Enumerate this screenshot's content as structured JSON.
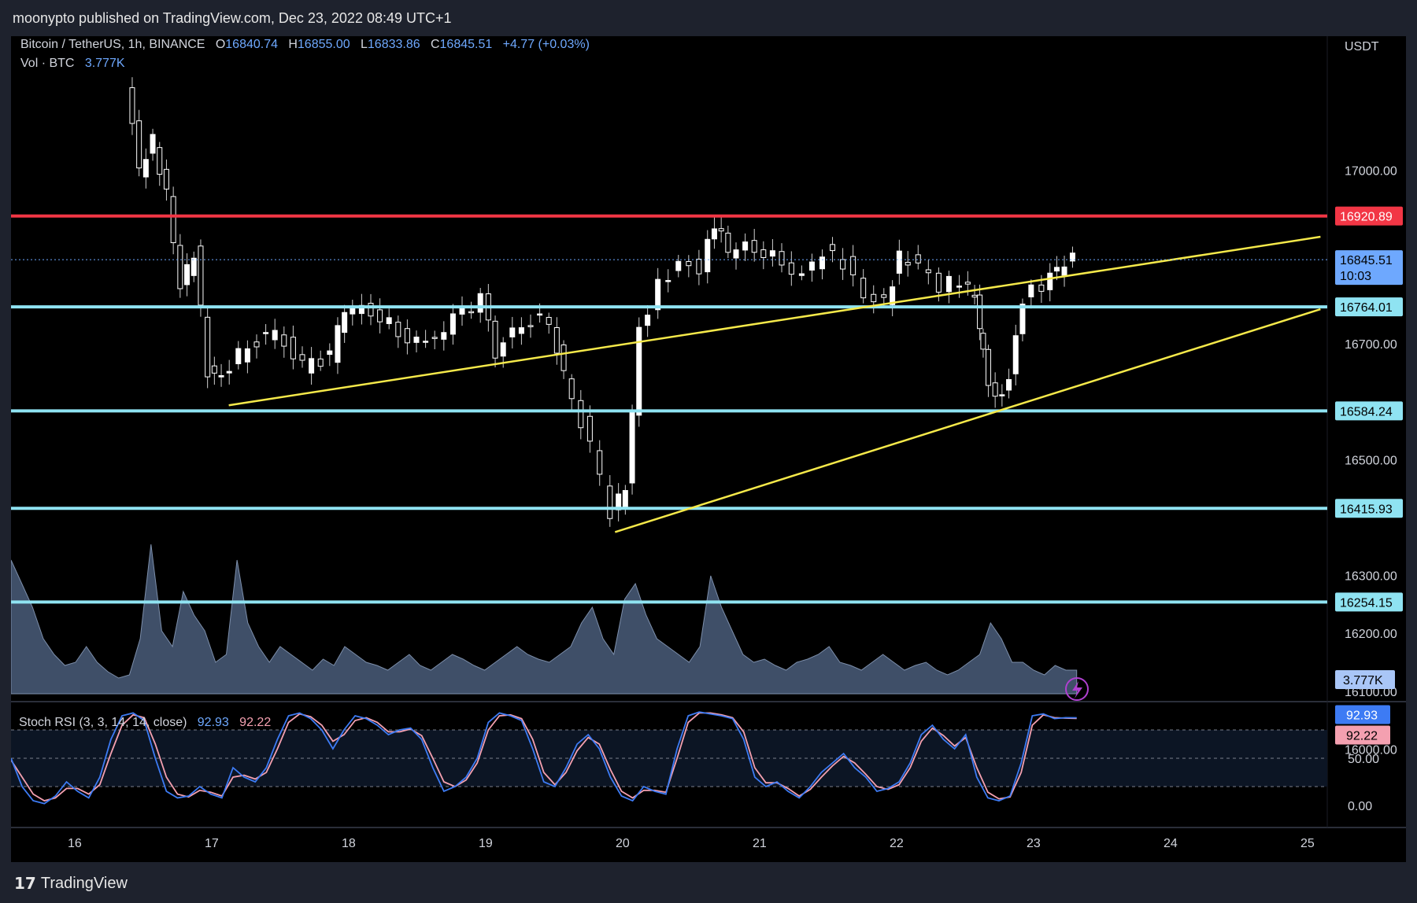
{
  "header": {
    "published": "moonypto published on TradingView.com, Dec 23, 2022 08:49 UTC+1"
  },
  "legend": {
    "symbol": "Bitcoin / TetherUS, 1h, BINANCE",
    "open_label": "O",
    "open": "16840.74",
    "high_label": "H",
    "high": "16855.00",
    "low_label": "L",
    "low": "16833.86",
    "close_label": "C",
    "close": "16845.51",
    "change": "+4.77 (+0.03%)",
    "vol_label": "Vol · BTC",
    "vol_value": "3.777K"
  },
  "stoch_legend": {
    "label": "Stoch RSI (3, 3, 14, 14, close)",
    "k": "92.93",
    "d": "92.22"
  },
  "footer": {
    "logo": "17",
    "brand": "TradingView"
  },
  "colors": {
    "up": "#ffffff",
    "down": "#ffffff",
    "support": "#8fe3f2",
    "resistance": "#f23645",
    "trend": "#f5e94a",
    "volume": "#4a5d7a",
    "k_line": "#3d7bf4",
    "d_line": "#f4a0b0",
    "last_price": "#6ea8fe"
  },
  "chart_data": [
    {
      "type": "candlestick",
      "currency": "USDT",
      "yticks": [
        16200,
        16300,
        16500,
        16700,
        17000
      ],
      "ylim": [
        16150,
        17150
      ],
      "xticks": [
        "16",
        "17",
        "18",
        "19",
        "20",
        "21",
        "22",
        "23",
        "24",
        "25"
      ],
      "horizontal_levels": [
        {
          "value": 16920.89,
          "label": "16920.89",
          "kind": "resistance"
        },
        {
          "value": 16764.01,
          "label": "16764.01",
          "kind": "support"
        },
        {
          "value": 16584.24,
          "label": "16584.24",
          "kind": "support"
        },
        {
          "value": 16415.93,
          "label": "16415.93",
          "kind": "support"
        },
        {
          "value": 16254.15,
          "label": "16254.15",
          "kind": "support"
        }
      ],
      "last_price": {
        "value": 16845.51,
        "label": "16845.51",
        "countdown": "10:03"
      },
      "trendlines": [
        {
          "x1": 17.13,
          "y1": 16594,
          "x2": 25.1,
          "y2": 16885
        },
        {
          "x1": 19.95,
          "y1": 16375,
          "x2": 25.1,
          "y2": 16760
        }
      ],
      "price_points": [
        [
          16.4,
          17150
        ],
        [
          16.5,
          17000
        ],
        [
          16.6,
          17050
        ],
        [
          16.7,
          16960
        ],
        [
          16.8,
          16800
        ],
        [
          16.9,
          16860
        ],
        [
          17.0,
          16650
        ],
        [
          17.1,
          16640
        ],
        [
          17.3,
          16700
        ],
        [
          17.5,
          16720
        ],
        [
          17.7,
          16660
        ],
        [
          17.9,
          16680
        ],
        [
          18.0,
          16760
        ],
        [
          18.2,
          16760
        ],
        [
          18.4,
          16720
        ],
        [
          18.6,
          16700
        ],
        [
          18.8,
          16740
        ],
        [
          19.0,
          16780
        ],
        [
          19.1,
          16680
        ],
        [
          19.3,
          16740
        ],
        [
          19.5,
          16740
        ],
        [
          19.6,
          16650
        ],
        [
          19.8,
          16520
        ],
        [
          19.95,
          16410
        ],
        [
          20.05,
          16450
        ],
        [
          20.15,
          16720
        ],
        [
          20.3,
          16800
        ],
        [
          20.45,
          16840
        ],
        [
          20.6,
          16830
        ],
        [
          20.7,
          16910
        ],
        [
          20.8,
          16860
        ],
        [
          21.0,
          16870
        ],
        [
          21.2,
          16840
        ],
        [
          21.35,
          16820
        ],
        [
          21.5,
          16860
        ],
        [
          21.65,
          16840
        ],
        [
          21.8,
          16780
        ],
        [
          21.95,
          16770
        ],
        [
          22.05,
          16850
        ],
        [
          22.2,
          16840
        ],
        [
          22.35,
          16800
        ],
        [
          22.5,
          16810
        ],
        [
          22.6,
          16780
        ],
        [
          22.65,
          16680
        ],
        [
          22.75,
          16600
        ],
        [
          22.85,
          16640
        ],
        [
          22.95,
          16780
        ],
        [
          23.1,
          16800
        ],
        [
          23.2,
          16830
        ],
        [
          23.32,
          16845.51
        ]
      ]
    },
    {
      "type": "area",
      "series_name": "Vol · BTC",
      "yticks": [
        16000,
        16100
      ],
      "last_value_label": "3.777K",
      "values": [
        0.85,
        0.7,
        0.55,
        0.35,
        0.25,
        0.18,
        0.2,
        0.3,
        0.2,
        0.14,
        0.1,
        0.12,
        0.35,
        0.95,
        0.4,
        0.3,
        0.65,
        0.5,
        0.4,
        0.2,
        0.25,
        0.85,
        0.45,
        0.3,
        0.2,
        0.3,
        0.25,
        0.2,
        0.15,
        0.22,
        0.18,
        0.3,
        0.25,
        0.2,
        0.18,
        0.15,
        0.2,
        0.25,
        0.18,
        0.15,
        0.2,
        0.25,
        0.22,
        0.18,
        0.15,
        0.2,
        0.25,
        0.3,
        0.25,
        0.22,
        0.2,
        0.25,
        0.3,
        0.45,
        0.55,
        0.35,
        0.25,
        0.6,
        0.7,
        0.5,
        0.35,
        0.3,
        0.25,
        0.2,
        0.3,
        0.75,
        0.55,
        0.4,
        0.25,
        0.2,
        0.22,
        0.18,
        0.15,
        0.2,
        0.22,
        0.25,
        0.3,
        0.2,
        0.18,
        0.15,
        0.2,
        0.25,
        0.2,
        0.15,
        0.18,
        0.2,
        0.15,
        0.12,
        0.15,
        0.2,
        0.25,
        0.45,
        0.35,
        0.2,
        0.2,
        0.15,
        0.12,
        0.18,
        0.15,
        0.15
      ]
    },
    {
      "type": "line",
      "series_name": "Stoch RSI (3, 3, 14, 14, close)",
      "yticks": [
        0.0,
        50.0
      ],
      "ytick_labels": [
        "0.00",
        "50.00"
      ],
      "bands": [
        20,
        50,
        80
      ],
      "k_last_label": "92.93",
      "d_last_label": "92.22",
      "k": [
        50,
        20,
        5,
        2,
        10,
        25,
        15,
        8,
        30,
        70,
        95,
        98,
        90,
        50,
        15,
        8,
        10,
        20,
        12,
        8,
        40,
        30,
        25,
        40,
        70,
        95,
        98,
        92,
        80,
        60,
        80,
        95,
        92,
        85,
        75,
        80,
        82,
        70,
        40,
        15,
        20,
        30,
        50,
        88,
        98,
        95,
        90,
        60,
        25,
        20,
        40,
        65,
        75,
        60,
        30,
        10,
        5,
        20,
        15,
        12,
        60,
        95,
        99,
        97,
        95,
        92,
        70,
        30,
        20,
        25,
        15,
        8,
        20,
        35,
        45,
        55,
        40,
        30,
        15,
        18,
        25,
        45,
        75,
        85,
        70,
        60,
        75,
        30,
        8,
        5,
        10,
        45,
        95,
        97,
        92,
        93,
        92.93
      ],
      "d": [
        48,
        30,
        12,
        5,
        8,
        18,
        18,
        12,
        22,
        55,
        85,
        96,
        93,
        65,
        30,
        12,
        9,
        16,
        14,
        10,
        30,
        32,
        28,
        35,
        60,
        88,
        97,
        94,
        85,
        68,
        75,
        90,
        93,
        88,
        78,
        78,
        81,
        74,
        50,
        25,
        20,
        27,
        45,
        80,
        95,
        96,
        92,
        70,
        35,
        22,
        35,
        58,
        72,
        65,
        38,
        15,
        8,
        16,
        16,
        14,
        50,
        88,
        98,
        98,
        96,
        93,
        78,
        40,
        24,
        24,
        18,
        10,
        17,
        30,
        42,
        52,
        45,
        33,
        20,
        17,
        22,
        40,
        68,
        82,
        74,
        63,
        72,
        40,
        14,
        7,
        9,
        35,
        85,
        96,
        93,
        92.5,
        92.22
      ]
    }
  ]
}
